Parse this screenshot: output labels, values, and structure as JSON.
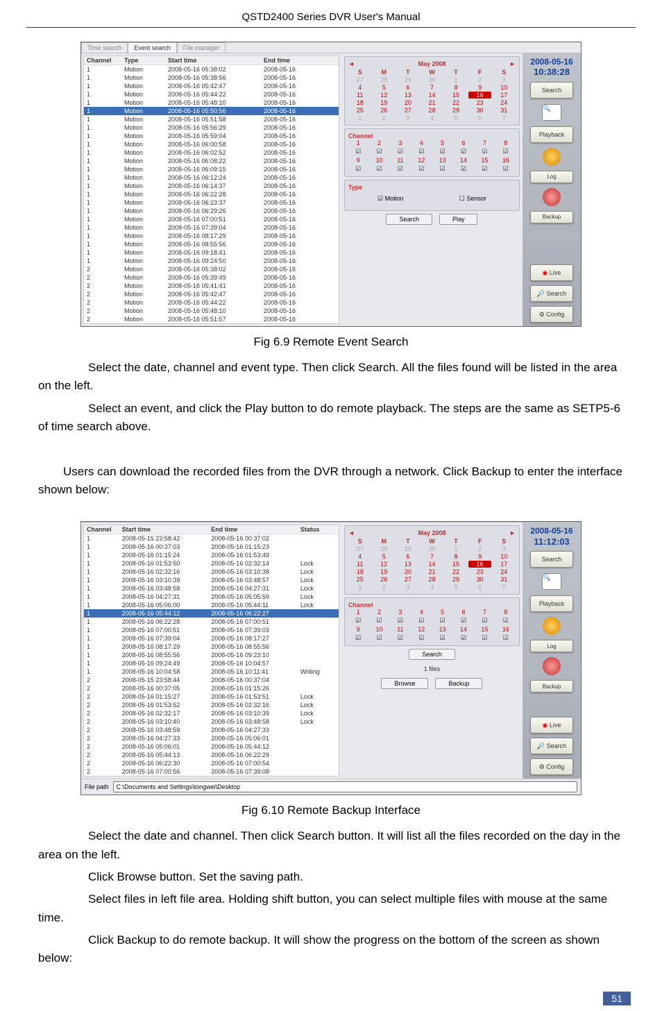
{
  "header": {
    "title": "QSTD2400 Series DVR User's Manual"
  },
  "fig1": {
    "caption": "Fig 6.9 Remote Event Search",
    "tabs": [
      "Time search",
      "Event search",
      "File manager"
    ],
    "headers": [
      "Channel",
      "Type",
      "Start time",
      "End time"
    ],
    "rows": [
      [
        "1",
        "Motion",
        "2008-05-16 05:38:02",
        "2008-05-16"
      ],
      [
        "1",
        "Motion",
        "2008-05-16 05:38:56",
        "2008-05-16"
      ],
      [
        "1",
        "Motion",
        "2008-05-16 05:42:47",
        "2008-05-16"
      ],
      [
        "1",
        "Motion",
        "2008-05-16 05:44:22",
        "2008-05-16"
      ],
      [
        "1",
        "Motion",
        "2008-05-16 05:48:10",
        "2008-05-16"
      ],
      [
        "1",
        "Motion",
        "2008-05-16 05:50:56",
        "2008-05-16"
      ],
      [
        "1",
        "Motion",
        "2008-05-16 05:51:58",
        "2008-05-16"
      ],
      [
        "1",
        "Motion",
        "2008-05-16 05:56:29",
        "2008-05-16"
      ],
      [
        "1",
        "Motion",
        "2008-05-16 05:59:04",
        "2008-05-16"
      ],
      [
        "1",
        "Motion",
        "2008-05-16 06:00:58",
        "2008-05-16"
      ],
      [
        "1",
        "Motion",
        "2008-05-16 06:02:52",
        "2008-05-16"
      ],
      [
        "1",
        "Motion",
        "2008-05-16 06:08:22",
        "2008-05-16"
      ],
      [
        "1",
        "Motion",
        "2008-05-16 06:09:15",
        "2008-05-16"
      ],
      [
        "1",
        "Motion",
        "2008-05-16 06:12:24",
        "2008-05-16"
      ],
      [
        "1",
        "Motion",
        "2008-05-16 06:14:37",
        "2008-05-16"
      ],
      [
        "1",
        "Motion",
        "2008-05-16 06:22:28",
        "2008-05-16"
      ],
      [
        "1",
        "Motion",
        "2008-05-16 06:23:37",
        "2008-05-16"
      ],
      [
        "1",
        "Motion",
        "2008-05-16 06:29:26",
        "2008-05-16"
      ],
      [
        "1",
        "Motion",
        "2008-05-16 07:00:51",
        "2008-05-16"
      ],
      [
        "1",
        "Motion",
        "2008-05-16 07:39:04",
        "2008-05-16"
      ],
      [
        "1",
        "Motion",
        "2008-05-16 08:17:29",
        "2008-05-16"
      ],
      [
        "1",
        "Motion",
        "2008-05-16 08:55:56",
        "2008-05-16"
      ],
      [
        "1",
        "Motion",
        "2008-05-16 09:18:41",
        "2008-05-16"
      ],
      [
        "1",
        "Motion",
        "2008-05-16 09:24:50",
        "2008-05-16"
      ],
      [
        "2",
        "Motion",
        "2008-05-16 05:38:02",
        "2008-05-16"
      ],
      [
        "2",
        "Motion",
        "2008-05-16 05:39:49",
        "2008-05-16"
      ],
      [
        "2",
        "Motion",
        "2008-05-16 05:41:41",
        "2008-05-16"
      ],
      [
        "2",
        "Motion",
        "2008-05-16 05:42:47",
        "2008-05-16"
      ],
      [
        "2",
        "Motion",
        "2008-05-16 05:44:22",
        "2008-05-16"
      ],
      [
        "2",
        "Motion",
        "2008-05-16 05:48:10",
        "2008-05-16"
      ],
      [
        "2",
        "Motion",
        "2008-05-16 05:51:57",
        "2008-05-16"
      ]
    ],
    "selected_row": 5,
    "calendar": {
      "title": "May 2008",
      "dow": [
        "S",
        "M",
        "T",
        "W",
        "T",
        "F",
        "S"
      ],
      "cells": [
        [
          "27",
          "28",
          "29",
          "30",
          "1",
          "2",
          "3"
        ],
        [
          "4",
          "5",
          "6",
          "7",
          "8",
          "9",
          "10"
        ],
        [
          "11",
          "12",
          "13",
          "14",
          "15",
          "16",
          "17"
        ],
        [
          "18",
          "19",
          "20",
          "21",
          "22",
          "23",
          "24"
        ],
        [
          "25",
          "26",
          "27",
          "28",
          "29",
          "30",
          "31"
        ],
        [
          "1",
          "2",
          "3",
          "4",
          "5",
          "6",
          "7"
        ]
      ],
      "highlight": "16"
    },
    "channel_label": "Channel",
    "type_label": "Type",
    "motion_label": "Motion",
    "sensor_label": "Sensor",
    "search_btn": "Search",
    "play_btn": "Play",
    "date": "2008-05-16",
    "time": "10:38:28",
    "side": [
      "Search",
      "Playback",
      "Log",
      "Backup",
      "Live",
      "Search",
      "Config"
    ]
  },
  "para1": "Select the date, channel and event type. Then click Search. All the files found will be listed in the area on the left.",
  "para2": "Select an event, and click the Play button to do remote playback. The steps are the same as SETP5-6 of time search above.",
  "para3": "Users can download the recorded files from the DVR through a network. Click Backup to enter the interface shown below:",
  "fig2": {
    "caption": "Fig 6.10   Remote Backup Interface",
    "headers": [
      "Channel",
      "Start time",
      "End time",
      "Status"
    ],
    "rows": [
      [
        "1",
        "2008-05-15 23:58:42",
        "2008-05-16 00:37:02",
        ""
      ],
      [
        "1",
        "2008-05-16 00:37:03",
        "2008-05-16 01:15:23",
        ""
      ],
      [
        "1",
        "2008-05-16 01:15:24",
        "2008-05-16 01:53:49",
        ""
      ],
      [
        "1",
        "2008-05-16 01:53:50",
        "2008-05-16 02:32:14",
        "Lock"
      ],
      [
        "1",
        "2008-05-16 02:32:16",
        "2008-05-16 03:10:38",
        "Lock"
      ],
      [
        "1",
        "2008-05-16 03:10:39",
        "2008-05-16 03:48:57",
        "Lock"
      ],
      [
        "1",
        "2008-05-16 03:48:58",
        "2008-05-16 04:27:31",
        "Lock"
      ],
      [
        "1",
        "2008-05-16 04:27:31",
        "2008-05-16 05:05:59",
        "Lock"
      ],
      [
        "1",
        "2008-05-16 05:06:00",
        "2008-05-16 05:44:11",
        "Lock"
      ],
      [
        "1",
        "2008-05-16 05:44:12",
        "2008-05-16 06:22:27",
        ""
      ],
      [
        "1",
        "2008-05-16 06:22:28",
        "2008-05-16 07:00:51",
        ""
      ],
      [
        "1",
        "2008-05-16 07:00:51",
        "2008-05-16 07:39:03",
        ""
      ],
      [
        "1",
        "2008-05-16 07:39:04",
        "2008-05-16 08:17:27",
        ""
      ],
      [
        "1",
        "2008-05-16 08:17:29",
        "2008-05-16 08:55:56",
        ""
      ],
      [
        "1",
        "2008-05-16 08:55:56",
        "2008-05-16 09:23:10",
        ""
      ],
      [
        "1",
        "2008-05-16 09:24:49",
        "2008-05-16 10:04:57",
        ""
      ],
      [
        "1",
        "2008-05-16 10:04:58",
        "2008-05-16 10:11:41",
        "Writing"
      ],
      [
        "2",
        "2008-05-15 23:58:44",
        "2008-05-16 00:37:04",
        ""
      ],
      [
        "2",
        "2008-05-16 00:37:05",
        "2008-05-16 01:15:26",
        ""
      ],
      [
        "2",
        "2008-05-16 01:15:27",
        "2008-05-16 01:53:51",
        "Lock"
      ],
      [
        "2",
        "2008-05-16 01:53:52",
        "2008-05-16 02:32:16",
        "Lock"
      ],
      [
        "2",
        "2008-05-16 02:32:17",
        "2008-05-16 03:10:39",
        "Lock"
      ],
      [
        "2",
        "2008-05-16 03:10:40",
        "2008-05-16 03:48:58",
        "Lock"
      ],
      [
        "2",
        "2008-05-16 03:48:59",
        "2008-05-16 04:27:33",
        ""
      ],
      [
        "2",
        "2008-05-16 04:27:33",
        "2008-05-16 05:06:01",
        ""
      ],
      [
        "2",
        "2008-05-16 05:06:01",
        "2008-05-16 05:44:12",
        ""
      ],
      [
        "2",
        "2008-05-16 05:44:13",
        "2008-05-16 06:22:29",
        ""
      ],
      [
        "2",
        "2008-05-16 06:22:30",
        "2008-05-16 07:00:54",
        ""
      ],
      [
        "2",
        "2008-05-16 07:00:56",
        "2008-05-16 07:39:08",
        ""
      ]
    ],
    "selected_row": 9,
    "search_btn": "Search",
    "browse_btn": "Browse",
    "backup_btn": "Backup",
    "channel_label": "Channel",
    "files_label": "1 files",
    "path_label": "File path",
    "path_value": "C:\\Documents and Settings\\tongwei\\Desktop",
    "date": "2008-05-16",
    "time": "11:12:03",
    "side": [
      "Search",
      "Playback",
      "Log",
      "Backup",
      "Live",
      "Search",
      "Config"
    ]
  },
  "para4": "Select the date and channel. Then click Search button. It will list all the files recorded on the day in the area on the left.",
  "para5": "Click Browse button. Set the saving path.",
  "para6": "Select files in left file area. Holding shift button, you can select multiple files with mouse at the same time.",
  "para7": "Click Backup to do remote backup. It will show the progress on the bottom of the screen as shown below:",
  "page_number": "51"
}
